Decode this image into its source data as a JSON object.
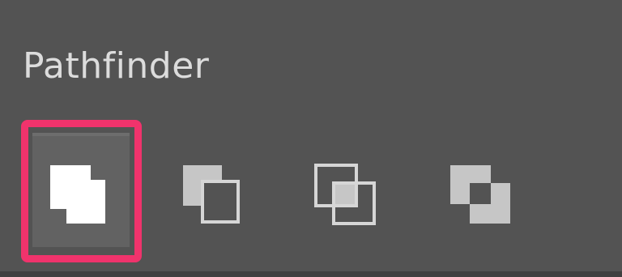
{
  "panel": {
    "title": "Pathfinder"
  },
  "shape_modes": [
    {
      "icon": "unite-icon",
      "selected": true
    },
    {
      "icon": "minus-front-icon",
      "selected": false
    },
    {
      "icon": "intersect-icon",
      "selected": false
    },
    {
      "icon": "exclude-icon",
      "selected": false
    }
  ],
  "colors": {
    "panel_bg": "#535353",
    "title": "#dcdcdc",
    "highlight": "#f0336c",
    "icon_white": "#ffffff",
    "icon_gray": "#c6c6c6",
    "icon_outline": "#d6d6d6"
  }
}
